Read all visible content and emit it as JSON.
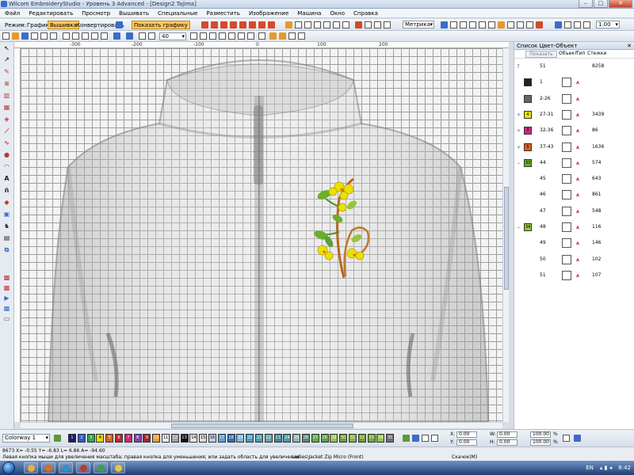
{
  "window": {
    "title": "Wilcom EmbroideryStudio - Уровень 3 Advanced - [Design2 Tajima]",
    "buttons": [
      "–",
      "□",
      "✕"
    ]
  },
  "menu": [
    "Файл",
    "Редактировать",
    "Просмотр",
    "Вышивать",
    "Специальные",
    "Разместить",
    "Изображение",
    "Машина",
    "Окно",
    "Справка"
  ],
  "toolbar": {
    "mode_label": "Режим:",
    "graphics_label": "Графика",
    "embroidery_label": "Вышивка",
    "convert_label": "Конвертировать",
    "show_graphics_label": "Показать графику",
    "zoom_value": "40",
    "units_value": "Метрика",
    "thickness_value": "1.00",
    "accent": "#f8c860"
  },
  "rulers": {
    "top_labels": [
      "-300",
      "-200",
      "-100",
      "0",
      "100",
      "200"
    ],
    "left_labels": []
  },
  "panel": {
    "title": "Список Цвет-Объект",
    "show_button": "Показать",
    "col_object": "Объект",
    "col_type": "Тип",
    "col_stitches": "Стежки",
    "rows": [
      {
        "tree": "7",
        "swatch": "",
        "swatch_color": "",
        "num": "51",
        "stitches": "8258"
      },
      {
        "tree": "",
        "swatch": "",
        "swatch_color": "#222222",
        "num": "1",
        "stitches": ""
      },
      {
        "tree": "",
        "swatch": "",
        "swatch_color": "#666666",
        "num": "2-26",
        "stitches": ""
      },
      {
        "tree": "+",
        "swatch": "4",
        "swatch_color": "#f0e000",
        "num": "27-31",
        "stitches": "3439"
      },
      {
        "tree": "+",
        "swatch": "7",
        "swatch_color": "#d0237c",
        "num": "32-36",
        "stitches": "86"
      },
      {
        "tree": "+",
        "swatch": "5",
        "swatch_color": "#d8601e",
        "num": "37-43",
        "stitches": "1636"
      },
      {
        "tree": "−",
        "swatch": "33",
        "swatch_color": "#6cae2a",
        "num": "44",
        "stitches": "574"
      },
      {
        "tree": "",
        "swatch": "",
        "swatch_color": "",
        "num": "45",
        "stitches": "643"
      },
      {
        "tree": "",
        "swatch": "",
        "swatch_color": "",
        "num": "46",
        "stitches": "861"
      },
      {
        "tree": "",
        "swatch": "",
        "swatch_color": "",
        "num": "47",
        "stitches": "548"
      },
      {
        "tree": "−",
        "swatch": "34",
        "swatch_color": "#96c43a",
        "num": "48",
        "stitches": "116"
      },
      {
        "tree": "",
        "swatch": "",
        "swatch_color": "",
        "num": "49",
        "stitches": "146"
      },
      {
        "tree": "",
        "swatch": "",
        "swatch_color": "",
        "num": "50",
        "stitches": "102"
      },
      {
        "tree": "",
        "swatch": "",
        "swatch_color": "",
        "num": "51",
        "stitches": "107"
      }
    ]
  },
  "colorbar": {
    "colorway": "Colorway 1",
    "chips": [
      {
        "n": "1",
        "c": "#1a1a6e"
      },
      {
        "n": "2",
        "c": "#2a5dc8"
      },
      {
        "n": "3",
        "c": "#2aa84a"
      },
      {
        "n": "4",
        "c": "#e8d800"
      },
      {
        "n": "5",
        "c": "#d8601e"
      },
      {
        "n": "6",
        "c": "#c02828"
      },
      {
        "n": "7",
        "c": "#d0237c"
      },
      {
        "n": "8",
        "c": "#8c3ab0"
      },
      {
        "n": "9",
        "c": "#9c2a2a"
      },
      {
        "n": "10",
        "c": "#e8a02a"
      },
      {
        "n": "11",
        "c": "#f0f0f0"
      },
      {
        "n": "12",
        "c": "#a0a0a0"
      },
      {
        "n": "13",
        "c": "#101010"
      },
      {
        "n": "14",
        "c": "#e8e8e8"
      },
      {
        "n": "15",
        "c": "#dcdcdc"
      },
      {
        "n": "16",
        "c": "#b8d0e8"
      },
      {
        "n": "17",
        "c": "#5aa0d8"
      },
      {
        "n": "18",
        "c": "#2a70b8"
      },
      {
        "n": "19",
        "c": "#7ab8e0"
      },
      {
        "n": "20",
        "c": "#3ca0c8"
      },
      {
        "n": "21",
        "c": "#4aa0b0"
      },
      {
        "n": "22",
        "c": "#68a0a8"
      },
      {
        "n": "23",
        "c": "#3c8a98"
      },
      {
        "n": "24",
        "c": "#4c9aa8"
      },
      {
        "n": "25",
        "c": "#88b8b0"
      },
      {
        "n": "26",
        "c": "#5a8878"
      },
      {
        "n": "27",
        "c": "#5ab048"
      },
      {
        "n": "28",
        "c": "#5aa048"
      },
      {
        "n": "29",
        "c": "#98c058"
      },
      {
        "n": "30",
        "c": "#6aa030"
      },
      {
        "n": "31",
        "c": "#88b040"
      },
      {
        "n": "32",
        "c": "#70a028"
      },
      {
        "n": "33",
        "c": "#6cae2a"
      },
      {
        "n": "34",
        "c": "#96c43a"
      },
      {
        "n": "35",
        "c": "#707070"
      }
    ],
    "x_label": "X:",
    "y_label": "Y:",
    "w_label": "W:",
    "h_label": "H:",
    "x_value": "0.00",
    "y_value": "0.00",
    "w_value": "0.00",
    "h_value": "0.00",
    "sx_value": "100.00",
    "sy_value": "100.00",
    "pct": "%"
  },
  "status": {
    "line1": "8673   X= -0.55 Y= -6.83 L= 6.86 A= -94.60",
    "line2": "Левая кнопка мыши для увеличения масштаба; правая кнопка для уменьшения; или задать область для увеличения",
    "garment": "Ladies\\Jacket Zip Micro (Front)",
    "mode": "Скачок(M)"
  },
  "taskbar": {
    "lang": "EN",
    "time": "8:42"
  }
}
